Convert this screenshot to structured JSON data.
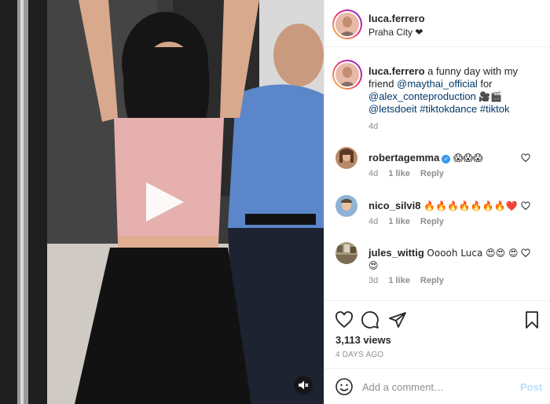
{
  "post": {
    "username": "luca.ferrero",
    "location": "Praha City ❤",
    "caption": {
      "username": "luca.ferrero",
      "text_1": "a funny day with my friend",
      "mention_1": "@maythai_official",
      "text_2": "for",
      "mention_2": "@alex_conteproduction",
      "emoji": "🎥🎬",
      "mention_3": "@letsdoeit",
      "hashtag_1": "#tiktokdance",
      "hashtag_2": "#tiktok",
      "time": "4d"
    },
    "comments": [
      {
        "username": "robertagemma",
        "verified": true,
        "text": "😱😱😱",
        "time": "4d",
        "likes": "1 like",
        "reply_label": "Reply"
      },
      {
        "username": "nico_silvi8",
        "verified": false,
        "text": "🔥🔥🔥🔥🔥🔥🔥❤️",
        "time": "4d",
        "likes": "1 like",
        "reply_label": "Reply"
      },
      {
        "username": "jules_wittig",
        "verified": false,
        "text": "Ooooh Luca 😍😍 😍😍",
        "time": "3d",
        "likes": "1 like",
        "reply_label": "Reply"
      }
    ],
    "views": "3,113 views",
    "posted_ago": "4 DAYS AGO",
    "comment_input": {
      "placeholder": "Add a comment…",
      "value": ""
    },
    "post_button": "Post"
  },
  "icons": {
    "like": "heart-icon",
    "comment": "comment-bubble-icon",
    "share": "paper-plane-icon",
    "save": "bookmark-icon",
    "emoji": "smiley-icon",
    "play": "play-icon",
    "mute": "speaker-muted-icon"
  },
  "colors": {
    "link": "#00376b",
    "muted": "#8e8e8e",
    "verified": "#3897f0",
    "post_disabled": "#b2dffc",
    "border": "#efefef"
  }
}
